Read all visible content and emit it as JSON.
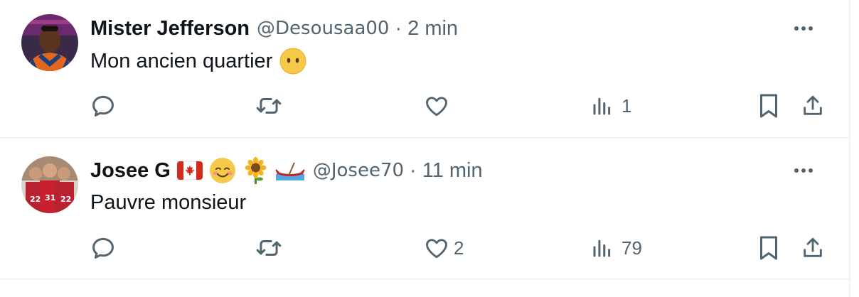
{
  "tweets": [
    {
      "display_name": "Mister Jefferson",
      "handle": "@Desousaa00",
      "separator": "·",
      "time": "2 min",
      "text": "Mon ancien quartier",
      "text_emoji": "neutral-face-emoji",
      "name_emojis": [],
      "actions": {
        "reply": {
          "icon": "reply-icon",
          "count": ""
        },
        "retweet": {
          "icon": "retweet-icon",
          "count": ""
        },
        "like": {
          "icon": "heart-icon",
          "count": ""
        },
        "views": {
          "icon": "views-icon",
          "count": "1"
        },
        "bookmark": {
          "icon": "bookmark-icon"
        },
        "share": {
          "icon": "share-icon"
        }
      }
    },
    {
      "display_name": "Josee G",
      "handle": "@Josee70",
      "separator": "·",
      "time": "11 min",
      "text": "Pauvre monsieur",
      "name_emojis": [
        "canada-flag-emoji",
        "smiling-face-emoji",
        "sunflower-emoji",
        "canoe-emoji"
      ],
      "actions": {
        "reply": {
          "icon": "reply-icon",
          "count": ""
        },
        "retweet": {
          "icon": "retweet-icon",
          "count": ""
        },
        "like": {
          "icon": "heart-icon",
          "count": "2"
        },
        "views": {
          "icon": "views-icon",
          "count": "79"
        },
        "bookmark": {
          "icon": "bookmark-icon"
        },
        "share": {
          "icon": "share-icon"
        }
      }
    }
  ],
  "colors": {
    "text_primary": "#0f1419",
    "text_secondary": "#536471",
    "divider": "#eff3f4"
  }
}
